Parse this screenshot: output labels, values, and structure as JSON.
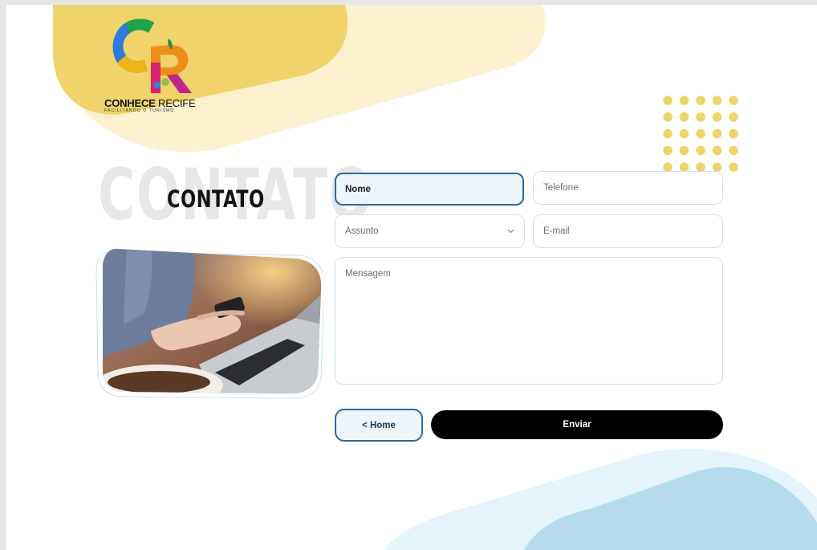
{
  "brand": {
    "name_bold": "CONHECE",
    "name_light": " RECIFE",
    "tagline": "FACILITANDO O TURISMO",
    "logo_letters": "CR"
  },
  "heading": {
    "background_text": "CONTATO",
    "title": "CONTATO"
  },
  "form": {
    "nome": "Nome",
    "telefone": "Telefone",
    "assunto": "Assunto",
    "email": "E-mail",
    "mensagem": "Mensagem"
  },
  "buttons": {
    "home": "< Home",
    "send": "Enviar"
  },
  "colors": {
    "yellow": "#f1d36c",
    "yellow_light": "#fbf1cf",
    "blue_light": "#e5f3fa",
    "blue": "#b4dcec",
    "accent_border": "#2d6a9a",
    "send_bg": "#000000"
  },
  "icons": {
    "assunto_dropdown": "chevron-down-icon",
    "logo": "conhece-recife-logo"
  }
}
